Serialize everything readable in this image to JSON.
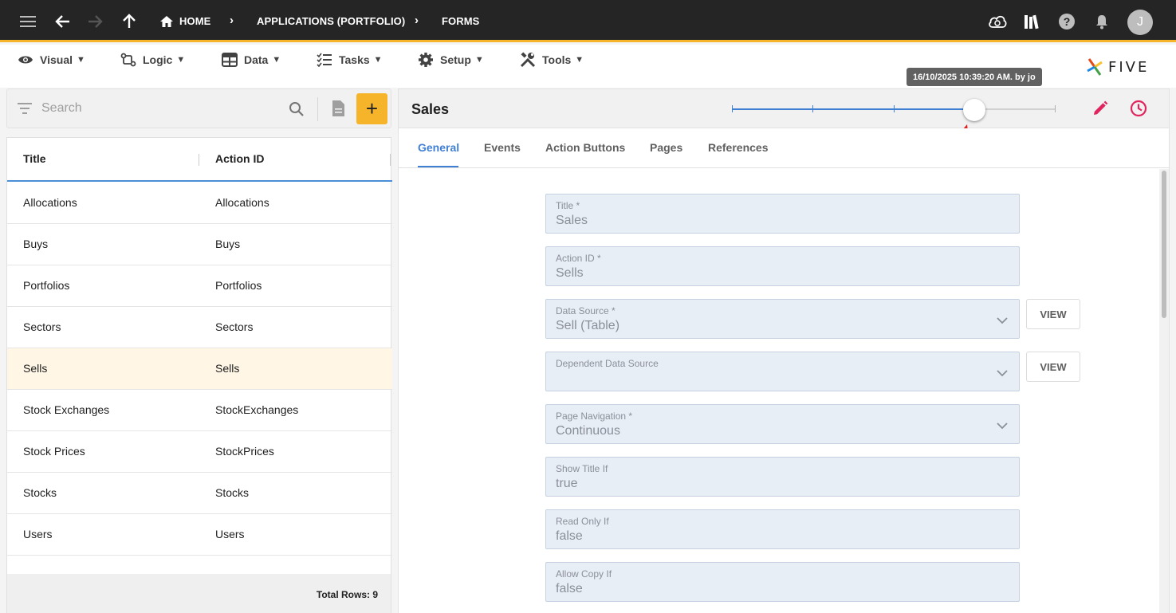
{
  "topbar": {
    "breadcrumbs": [
      "HOME",
      "APPLICATIONS (PORTFOLIO)",
      "FORMS"
    ],
    "user_initial": "J",
    "accent_color": "#f5b42a"
  },
  "menu": {
    "items": [
      {
        "label": "Visual",
        "icon": "eye-icon"
      },
      {
        "label": "Logic",
        "icon": "logic-icon"
      },
      {
        "label": "Data",
        "icon": "table-icon"
      },
      {
        "label": "Tasks",
        "icon": "tasks-icon"
      },
      {
        "label": "Setup",
        "icon": "gear-icon"
      },
      {
        "label": "Tools",
        "icon": "tools-icon"
      }
    ],
    "caret": "▼",
    "brand": "FIVE"
  },
  "left": {
    "search_placeholder": "Search",
    "add_label": "+",
    "columns": [
      "Title",
      "Action ID"
    ],
    "rows": [
      {
        "title": "Allocations",
        "action_id": "Allocations"
      },
      {
        "title": "Buys",
        "action_id": "Buys"
      },
      {
        "title": "Portfolios",
        "action_id": "Portfolios"
      },
      {
        "title": "Sectors",
        "action_id": "Sectors"
      },
      {
        "title": "Sells",
        "action_id": "Sells",
        "selected": true
      },
      {
        "title": "Stock Exchanges",
        "action_id": "StockExchanges"
      },
      {
        "title": "Stock Prices",
        "action_id": "StockPrices"
      },
      {
        "title": "Stocks",
        "action_id": "Stocks"
      },
      {
        "title": "Users",
        "action_id": "Users"
      }
    ],
    "total_rows": "Total Rows: 9"
  },
  "right": {
    "title": "Sales",
    "history_tooltip": "16/10/2025 10:39:20 AM. by jo",
    "history_position": 0.75,
    "history_points": 4,
    "tabs": [
      "General",
      "Events",
      "Action Buttons",
      "Pages",
      "References"
    ],
    "active_tab": "General",
    "fields": [
      {
        "label": "Title *",
        "value": "Sales",
        "dropdown": false
      },
      {
        "label": "Action ID *",
        "value": "Sells",
        "dropdown": false
      },
      {
        "label": "Data Source *",
        "value": "Sell (Table)",
        "dropdown": true,
        "view": "VIEW"
      },
      {
        "label": "Dependent Data Source",
        "value": "",
        "dropdown": true,
        "view": "VIEW"
      },
      {
        "label": "Page Navigation *",
        "value": "Continuous",
        "dropdown": true
      },
      {
        "label": "Show Title If",
        "value": "true",
        "dropdown": false
      },
      {
        "label": "Read Only If",
        "value": "false",
        "dropdown": false
      },
      {
        "label": "Allow Copy If",
        "value": "false",
        "dropdown": false
      }
    ],
    "accent_color": "#3f7fd4",
    "action_color": "#e0245e"
  }
}
